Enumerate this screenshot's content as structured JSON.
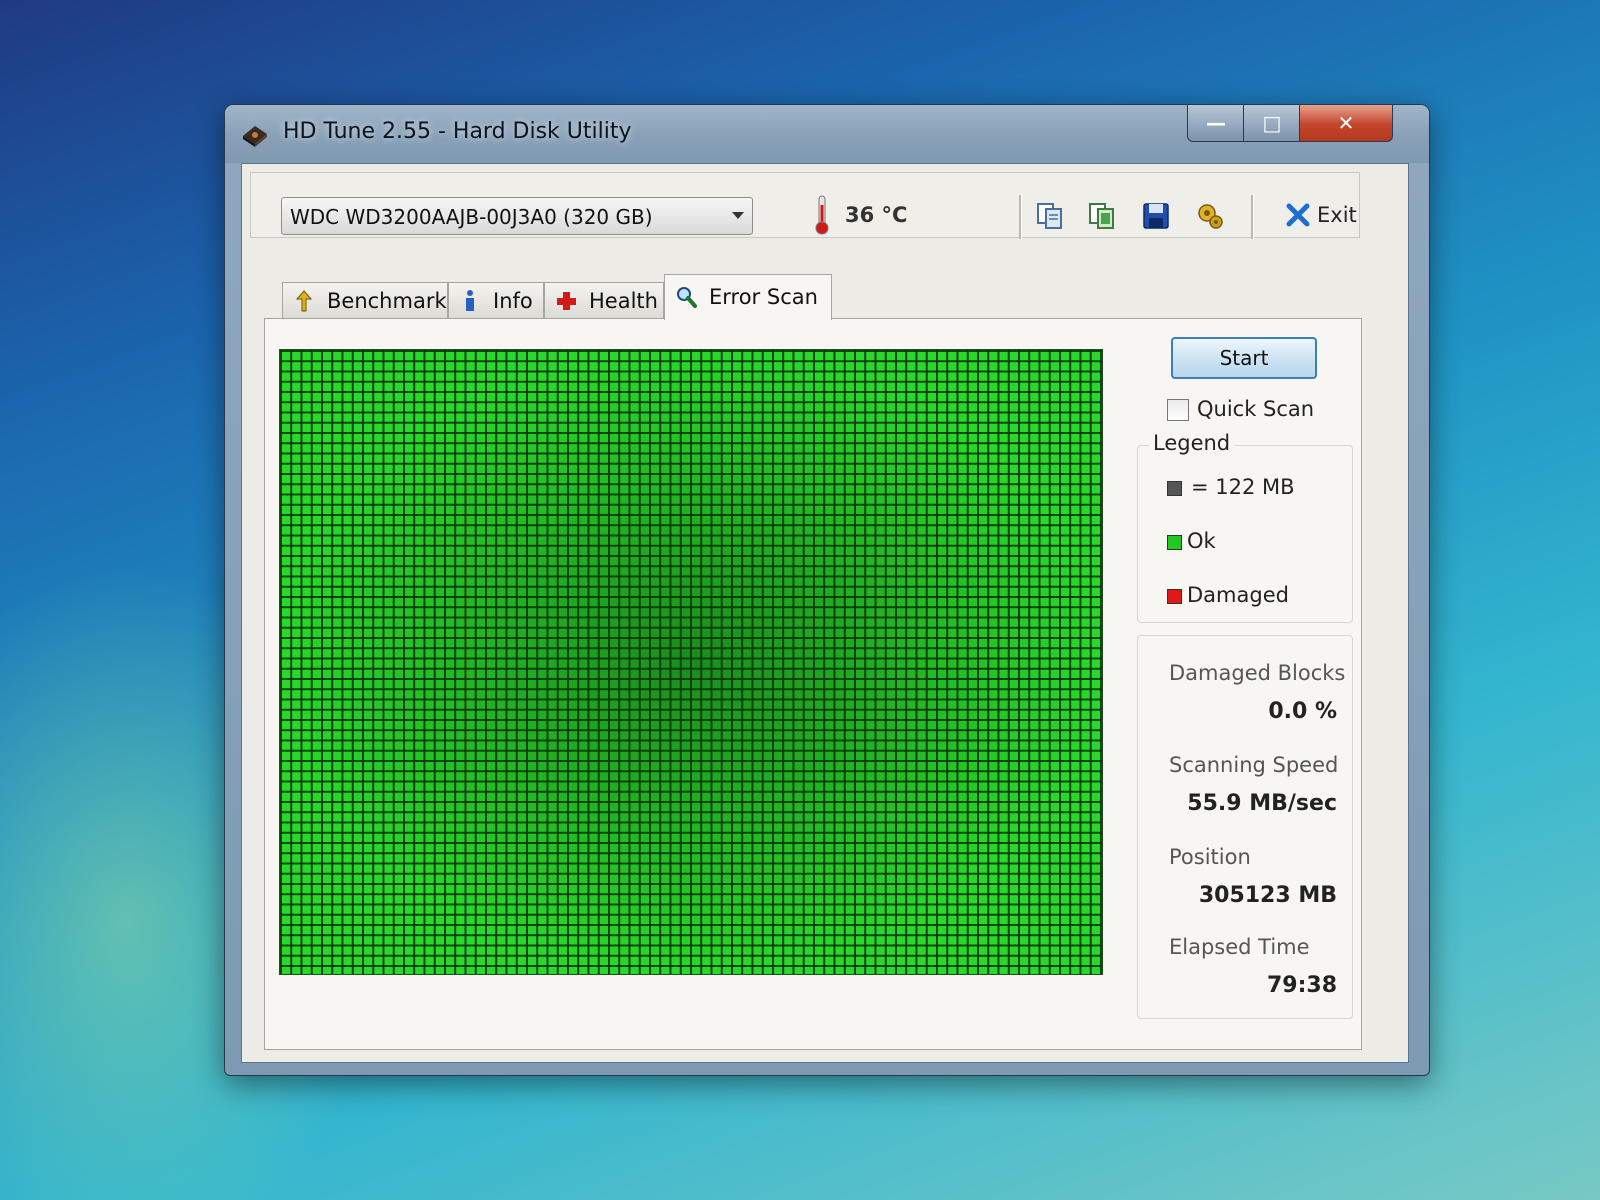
{
  "window": {
    "title": "HD Tune 2.55 - Hard Disk Utility",
    "minimize_label": "—",
    "maximize_label": "□",
    "close_label": "✕"
  },
  "toolbar": {
    "drive": "WDC WD3200AAJB-00J3A0 (320 GB)",
    "temperature": "36 °C",
    "exit_label": "Exit",
    "icons": [
      "copy-icon",
      "copy-all-icon",
      "save-icon",
      "options-icon"
    ]
  },
  "tabs": [
    {
      "label": "Benchmark",
      "icon": "benchmark-icon"
    },
    {
      "label": "Info",
      "icon": "info-icon"
    },
    {
      "label": "Health",
      "icon": "health-icon"
    },
    {
      "label": "Error Scan",
      "icon": "magnifier-icon",
      "active": true
    }
  ],
  "error_scan": {
    "start_label": "Start",
    "quick_scan_label": "Quick Scan",
    "quick_scan_checked": false,
    "legend_title": "Legend",
    "legend": [
      {
        "text": "= 122 MB",
        "color": "#555555"
      },
      {
        "text": "Ok",
        "color": "#22c922"
      },
      {
        "text": "Damaged",
        "color": "#e01818"
      }
    ],
    "stats": {
      "damaged_blocks_label": "Damaged Blocks",
      "damaged_blocks_value": "0.0 %",
      "scanning_speed_label": "Scanning Speed",
      "scanning_speed_value": "55.9 MB/sec",
      "position_label": "Position",
      "position_value": "305123 MB",
      "elapsed_time_label": "Elapsed Time",
      "elapsed_time_value": "79:38"
    },
    "block_status_color": "#29d82a"
  }
}
